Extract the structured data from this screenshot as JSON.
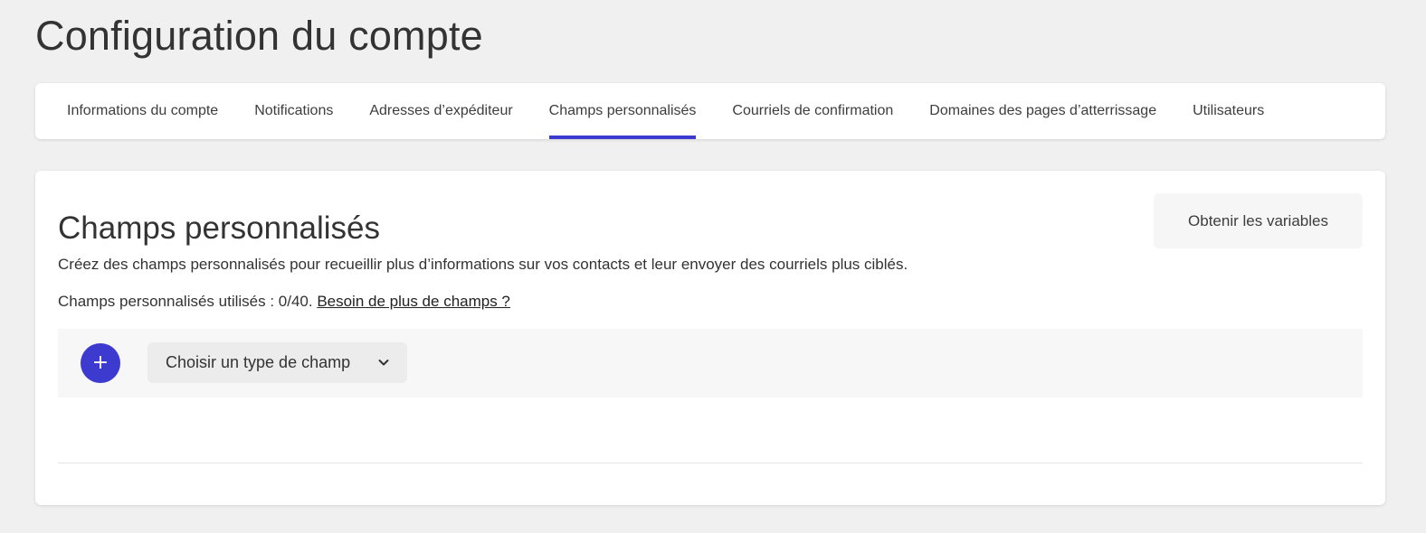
{
  "page": {
    "title": "Configuration du compte"
  },
  "tabs": [
    {
      "label": "Informations du compte",
      "active": false
    },
    {
      "label": "Notifications",
      "active": false
    },
    {
      "label": "Adresses d’expéditeur",
      "active": false
    },
    {
      "label": "Champs personnalisés",
      "active": true
    },
    {
      "label": "Courriels de confirmation",
      "active": false
    },
    {
      "label": "Domaines des pages d’atterrissage",
      "active": false
    },
    {
      "label": "Utilisateurs",
      "active": false
    }
  ],
  "section": {
    "title": "Champs personnalisés",
    "description": "Créez des champs personnalisés pour recueillir plus d’informations sur vos contacts et leur envoyer des courriels plus ciblés.",
    "usage_text": "Champs personnalisés utilisés : 0/40. ",
    "more_fields_link": "Besoin de plus de champs ?",
    "get_variables_button": "Obtenir les variables"
  },
  "field_row": {
    "add_button_label": "+",
    "type_select_value": "Choisir un type de champ",
    "type_select_icon": "chevron-down-icon"
  },
  "colors": {
    "accent": "#3d3acf",
    "background": "#f0f0f0",
    "card": "#ffffff"
  }
}
